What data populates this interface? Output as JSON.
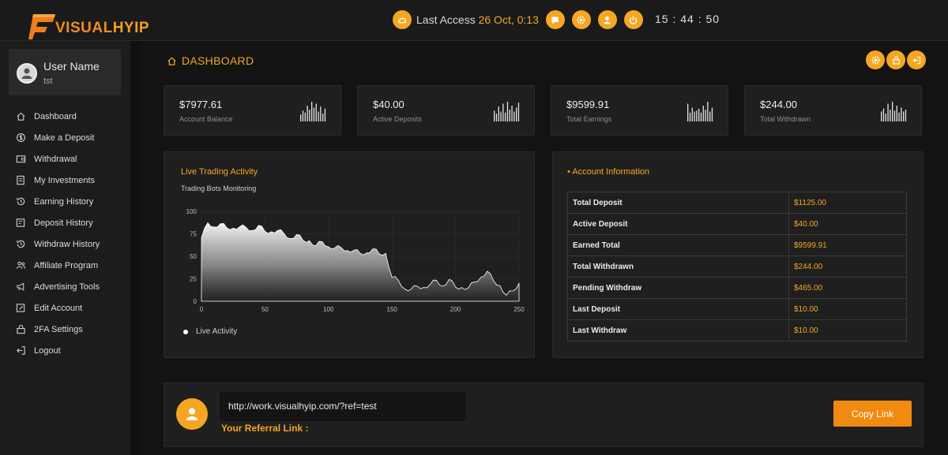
{
  "brand": {
    "name_a": "VISUAL",
    "name_b": "HYIP"
  },
  "topbar": {
    "access_label": "Last Access",
    "access_value": "26 Oct, 0:13",
    "clock": "15 : 44 : 50",
    "icons": [
      "cloud-icon",
      "chat-icon",
      "gear-icon",
      "user-icon",
      "power-icon"
    ]
  },
  "user": {
    "name": "User Name",
    "id": "tst"
  },
  "menu": [
    {
      "label": "Dashboard",
      "icon": "home-icon"
    },
    {
      "label": "Make a Deposit",
      "icon": "dollar-icon"
    },
    {
      "label": "Withdrawal",
      "icon": "wallet-icon"
    },
    {
      "label": "My Investments",
      "icon": "investments-icon"
    },
    {
      "label": "Earning History",
      "icon": "history-icon"
    },
    {
      "label": "Deposit History",
      "icon": "deposit-history-icon"
    },
    {
      "label": "Withdraw History",
      "icon": "withdraw-history-icon"
    },
    {
      "label": "Affiliate Program",
      "icon": "users-icon"
    },
    {
      "label": "Advertising Tools",
      "icon": "megaphone-icon"
    },
    {
      "label": "Edit Account",
      "icon": "edit-icon"
    },
    {
      "label": "2FA Settings",
      "icon": "lock-icon"
    },
    {
      "label": "Logout",
      "icon": "logout-icon"
    }
  ],
  "dashboard": {
    "title": "DASHBOARD"
  },
  "stats": [
    {
      "value": "$7977.61",
      "label": "Account Balance"
    },
    {
      "value": "$40.00",
      "label": "Active Deposits"
    },
    {
      "value": "$9599.91",
      "label": "Total Earnings"
    },
    {
      "value": "$244.00",
      "label": "Total Withdrawn"
    }
  ],
  "trading": {
    "title": "Live Trading Activity",
    "subtitle": "Trading Bots Monitoring",
    "legend": "Live Activity"
  },
  "chart_data": {
    "type": "area",
    "x": [
      0,
      5,
      10,
      15,
      20,
      25,
      30,
      35,
      40,
      45,
      50,
      55,
      60,
      65,
      70,
      75,
      80,
      85,
      90,
      95,
      100,
      105,
      110,
      115,
      120,
      125,
      130,
      135,
      140,
      145,
      150,
      155,
      160,
      165,
      170,
      175,
      180,
      185,
      190,
      195,
      200,
      205,
      210,
      215,
      220,
      225,
      230,
      235,
      240,
      245,
      250
    ],
    "series": [
      {
        "values": [
          72,
          86,
          84,
          85,
          83,
          80,
          84,
          81,
          80,
          83,
          79,
          76,
          80,
          74,
          71,
          73,
          69,
          66,
          63,
          65,
          62,
          58,
          61,
          55,
          58,
          52,
          55,
          57,
          54,
          52,
          28,
          22,
          15,
          12,
          18,
          14,
          20,
          22,
          18,
          23,
          17,
          14,
          16,
          20,
          28,
          32,
          24,
          16,
          8,
          10,
          21
        ]
      }
    ],
    "xlim": [
      0,
      250
    ],
    "ylim": [
      0,
      100
    ],
    "xticks": [
      0,
      50,
      100,
      150,
      200,
      250
    ],
    "yticks": [
      0,
      25,
      50,
      75,
      100
    ],
    "grid": true
  },
  "account_info": {
    "title": "• Account Information",
    "rows": [
      {
        "label": "Total Deposit",
        "value": "$1125.00"
      },
      {
        "label": "Active Deposit",
        "value": "$40.00"
      },
      {
        "label": "Earned Total",
        "value": "$9599.91"
      },
      {
        "label": "Total Withdrawn",
        "value": "$244.00"
      },
      {
        "label": "Pending Withdraw",
        "value": "$465.00"
      },
      {
        "label": "Last Deposit",
        "value": "$10.00"
      },
      {
        "label": "Last Withdraw",
        "value": "$10.00"
      }
    ]
  },
  "referral": {
    "link": "http://work.visualhyip.com/?ref=test",
    "label": "Your Referral Link :",
    "button": "Copy Link"
  },
  "colors": {
    "accent": "#f5a623",
    "button": "#f08a10",
    "panel": "#1f1f1f",
    "background": "#131313"
  }
}
